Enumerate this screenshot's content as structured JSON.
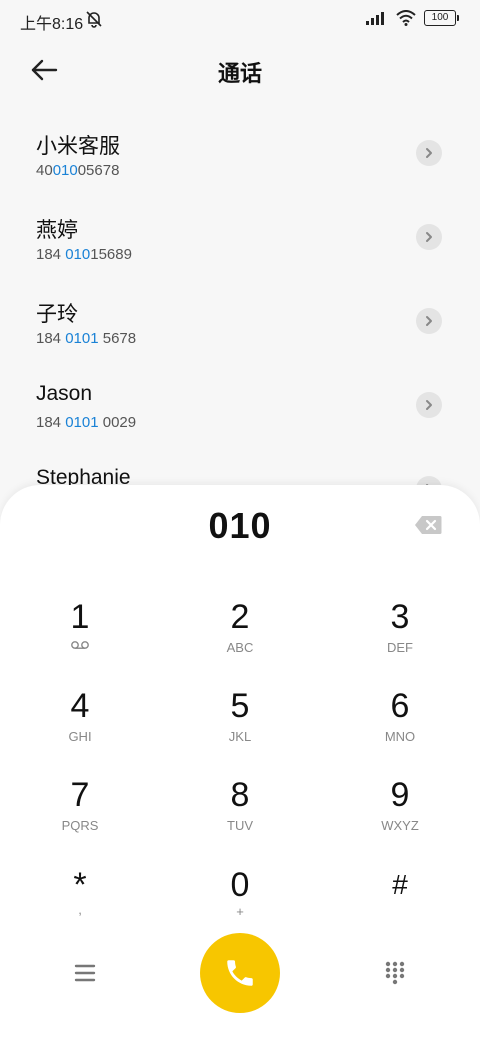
{
  "status_bar": {
    "time": "上午8:16",
    "battery": "100"
  },
  "header": {
    "title": "通话"
  },
  "contacts": [
    {
      "name": "小米客服",
      "number_pre": "40",
      "number_hl": "010",
      "number_post": "05678"
    },
    {
      "name": "燕婷",
      "number_pre": "184 ",
      "number_hl": "010",
      "number_post": "15689"
    },
    {
      "name": "子玲",
      "number_pre": "184 ",
      "number_hl": "0101",
      "number_post": " 5678"
    },
    {
      "name": "Jason",
      "number_pre": "184 ",
      "number_hl": "0101",
      "number_post": " 0029"
    },
    {
      "name": "Stephanie",
      "number_pre": "",
      "number_hl": "",
      "number_post": ""
    }
  ],
  "dialpad": {
    "input_value": "010",
    "keys": [
      {
        "digit": "1",
        "sub": ""
      },
      {
        "digit": "2",
        "sub": "ABC"
      },
      {
        "digit": "3",
        "sub": "DEF"
      },
      {
        "digit": "4",
        "sub": "GHI"
      },
      {
        "digit": "5",
        "sub": "JKL"
      },
      {
        "digit": "6",
        "sub": "MNO"
      },
      {
        "digit": "7",
        "sub": "PQRS"
      },
      {
        "digit": "8",
        "sub": "TUV"
      },
      {
        "digit": "9",
        "sub": "WXYZ"
      },
      {
        "digit": "*",
        "sub": ","
      },
      {
        "digit": "0",
        "sub": "+"
      },
      {
        "digit": "#",
        "sub": ""
      }
    ]
  },
  "colors": {
    "accent_call": "#f7c600",
    "highlight": "#1a82d6"
  }
}
